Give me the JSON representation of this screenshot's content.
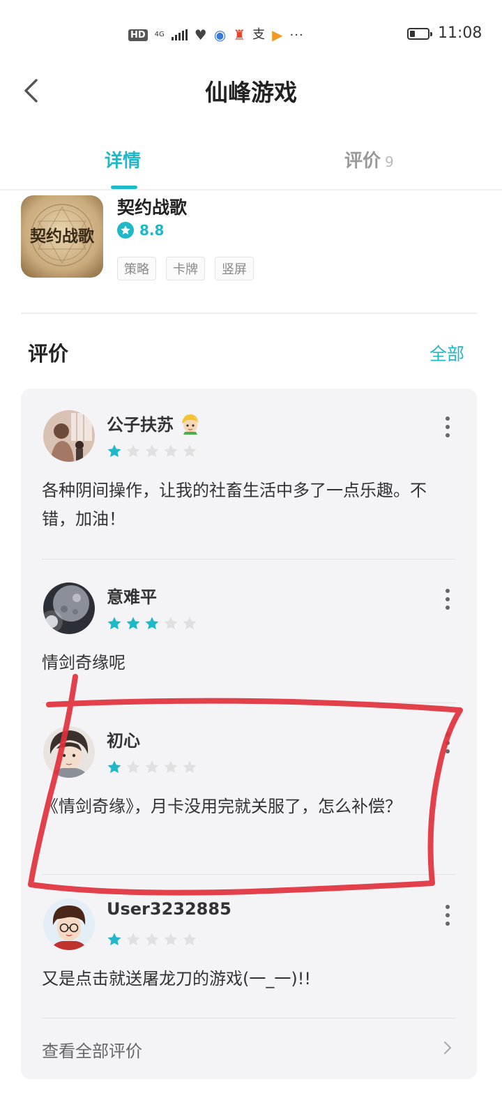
{
  "status_bar": {
    "hd": "HD",
    "network": "4G",
    "time": "11:08",
    "more": "···"
  },
  "header": {
    "title": "仙峰游戏",
    "back_icon": "chevron-left-icon"
  },
  "tabs": [
    {
      "label": "详情",
      "active": true
    },
    {
      "label": "评价",
      "count": "9",
      "active": false
    }
  ],
  "game": {
    "name": "契约战歌",
    "icon_text": "契约战歌",
    "rating": "8.8",
    "tags": [
      "策略",
      "卡牌",
      "竖屏"
    ]
  },
  "reviews_section": {
    "title": "评价",
    "view_all": "全部",
    "footer_label": "查看全部评价"
  },
  "reviews": [
    {
      "name": "公子扶苏",
      "stars": 1,
      "text": "各种阴间操作，让我的社畜生活中多了一点乐趣。不错，加油！"
    },
    {
      "name": "意难平",
      "stars": 3,
      "text": "情剑奇缘呢"
    },
    {
      "name": "初心",
      "stars": 1,
      "text": "《情剑奇缘》，月卡没用完就关服了，怎么补偿？"
    },
    {
      "name": "User3232885",
      "stars": 1,
      "text": "又是点击就送屠龙刀的游戏(一_一)!!"
    }
  ],
  "colors": {
    "accent": "#1fb8c8",
    "star_empty": "#e0e0e0",
    "annotation": "#e0303c",
    "card_bg": "#f4f4f6"
  }
}
